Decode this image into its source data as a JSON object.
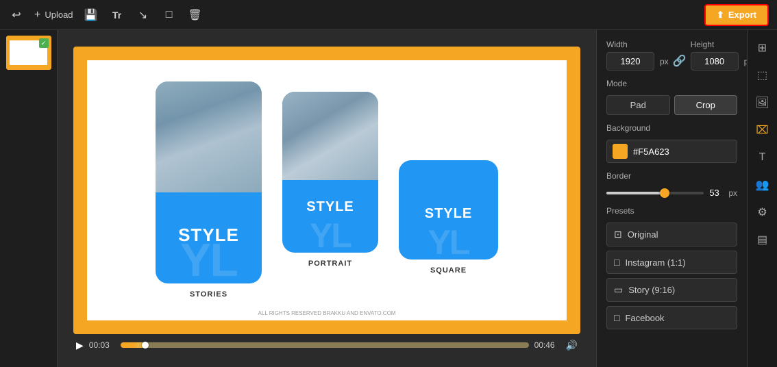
{
  "toolbar": {
    "upload_label": "Upload",
    "export_label": "Export"
  },
  "panel": {
    "width_label": "Width",
    "height_label": "Height",
    "width_value": "1920",
    "height_value": "1080",
    "unit": "px",
    "mode_label": "Mode",
    "mode_pad": "Pad",
    "mode_crop": "Crop",
    "background_label": "Background",
    "background_color": "#F5A623",
    "border_label": "Border",
    "border_value": "53",
    "border_unit": "px",
    "presets_label": "Presets",
    "preset_original": "Original",
    "preset_instagram": "Instagram (1:1)",
    "preset_story": "Story (9:16)",
    "preset_facebook": "Facebook"
  },
  "playback": {
    "time_start": "00:03",
    "time_end": "00:46"
  },
  "canvas": {
    "card1_label": "STYLE",
    "card1_caption": "STORIES",
    "card2_label": "STYLE",
    "card2_caption": "PORTRAIT",
    "card3_label": "STYLE",
    "card3_caption": "SQUARE",
    "footer_text": "ALL RIGHTS RESERVED BRAKKU AND ENVATO.COM"
  }
}
